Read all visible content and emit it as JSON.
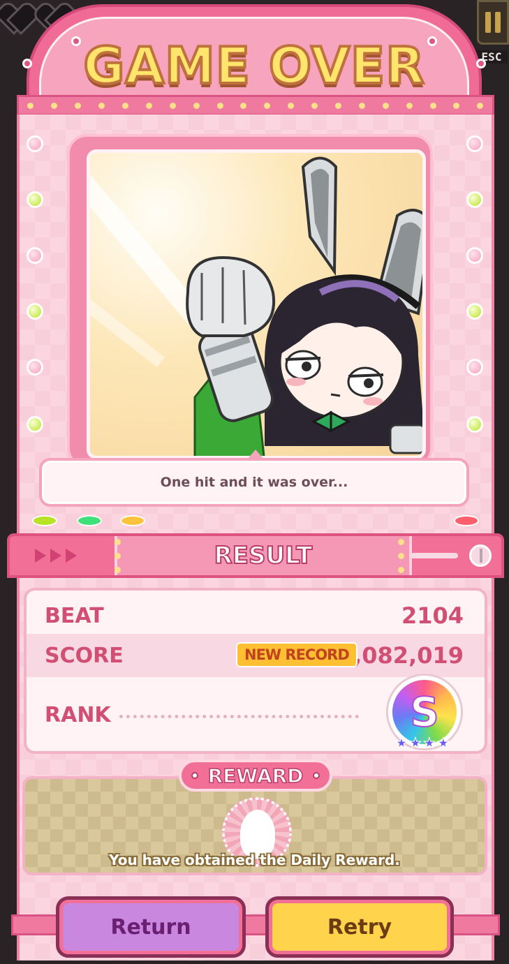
{
  "hud": {
    "esc_label": "ESC"
  },
  "game_over": {
    "title": "GAME OVER",
    "dialogue": "One hit and it was over..."
  },
  "result": {
    "title": "RESULT",
    "beat_label": "BEAT",
    "beat_value": "2104",
    "score_label": "SCORE",
    "new_record_label": "NEW RECORD",
    "score_value": "1,082,019",
    "rank_label": "RANK",
    "rank_value": "S",
    "rank_stars": 4
  },
  "reward": {
    "title": "REWARD",
    "message": "You have obtained the Daily Reward."
  },
  "buttons": {
    "return_label": "Return",
    "retry_label": "Retry"
  },
  "colors": {
    "accent_pink": "#f27098",
    "title_yellow": "#ffe56b",
    "stat_text": "#d14e74",
    "return_button": "#c987e0",
    "retry_button": "#ffd34c"
  }
}
